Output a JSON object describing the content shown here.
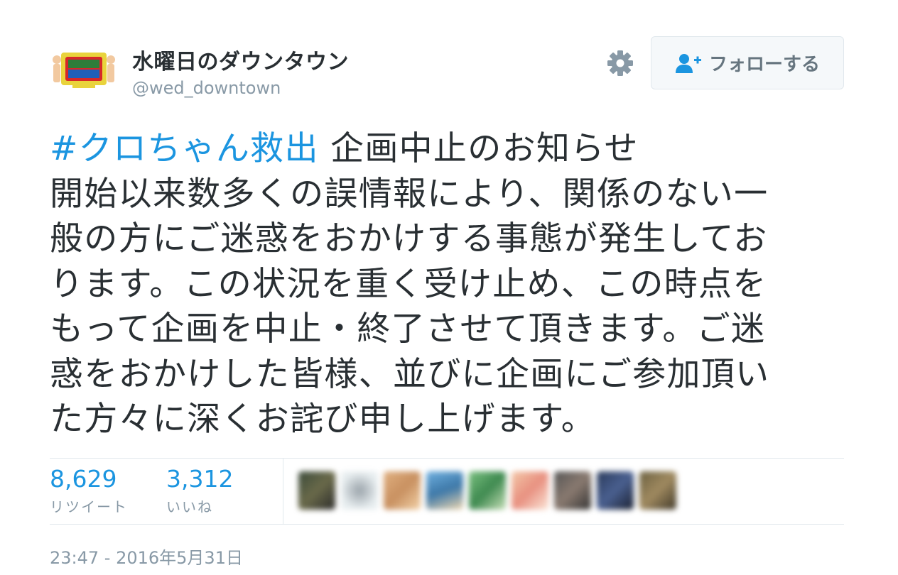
{
  "author": {
    "display_name": "水曜日のダウンタウン",
    "handle": "@wed_downtown"
  },
  "follow_button": {
    "label": "フォローする"
  },
  "tweet": {
    "hashtag": "#クロちゃん救出",
    "lines": [
      " 企画中止のお知らせ",
      "開始以来数多くの誤情報により、関係のない一",
      "般の方にご迷惑をおかけする事態が発生してお",
      "ります。この状況を重く受け止め、この時点を",
      "もって企画を中止・終了させて頂きます。ご迷",
      "惑をおかけした皆様、並びに企画にご参加頂い",
      "た方々に深くお詫び申し上げます。"
    ]
  },
  "stats": {
    "retweets": {
      "count": "8,629",
      "label": "リツイート"
    },
    "likes": {
      "count": "3,312",
      "label": "いいね"
    }
  },
  "likers_icons": [
    "avatar-1",
    "avatar-2",
    "avatar-3",
    "avatar-4",
    "avatar-5",
    "avatar-6",
    "avatar-7",
    "avatar-8",
    "avatar-9"
  ],
  "timestamp": "23:47 - 2016年5月31日",
  "colors": {
    "link": "#1b95e0",
    "text": "#292f33",
    "muted": "#8899a6",
    "border": "#e1e8ed"
  }
}
